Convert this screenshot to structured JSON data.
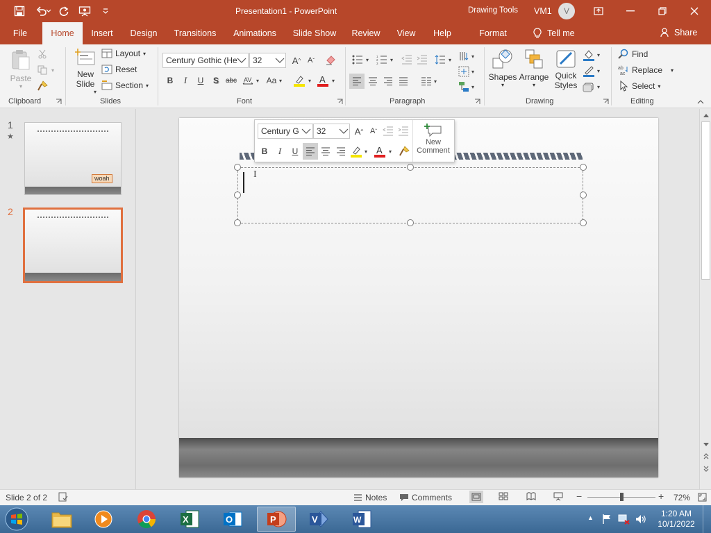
{
  "window": {
    "title": "Presentation1 - PowerPoint",
    "context_label": "Drawing Tools",
    "user_name": "VM1",
    "user_initial": "V"
  },
  "tabs": [
    "File",
    "Home",
    "Insert",
    "Design",
    "Transitions",
    "Animations",
    "Slide Show",
    "Review",
    "View",
    "Help",
    "Format"
  ],
  "active_tab": "Home",
  "tell_me": "Tell me",
  "share": "Share",
  "ribbon": {
    "clipboard": {
      "label": "Clipboard",
      "paste": "Paste"
    },
    "slides": {
      "label": "Slides",
      "new_slide_line1": "New",
      "new_slide_line2": "Slide",
      "layout": "Layout",
      "reset": "Reset",
      "section": "Section"
    },
    "font": {
      "label": "Font",
      "font_name": "Century Gothic (He",
      "font_size": "32",
      "change_case": "Aa"
    },
    "paragraph": {
      "label": "Paragraph"
    },
    "drawing": {
      "label": "Drawing",
      "shapes": "Shapes",
      "arrange": "Arrange",
      "quick_styles_line1": "Quick",
      "quick_styles_line2": "Styles"
    },
    "editing": {
      "label": "Editing",
      "find": "Find",
      "replace": "Replace",
      "select": "Select"
    }
  },
  "thumbnails": [
    {
      "number": "1",
      "tag": "woah"
    },
    {
      "number": "2"
    }
  ],
  "mini_toolbar": {
    "font_name": "Century G",
    "font_size": "32",
    "new_comment_line1": "New",
    "new_comment_line2": "Comment"
  },
  "status": {
    "slide_info": "Slide 2 of 2",
    "notes": "Notes",
    "comments": "Comments",
    "zoom": "72%",
    "zoom_fraction": 0.5
  },
  "taskbar": {
    "apps": [
      "start",
      "file-explorer",
      "media-player",
      "chrome",
      "excel",
      "outlook",
      "powerpoint",
      "visio",
      "word"
    ],
    "active_app": "powerpoint",
    "time": "1:20 AM",
    "date": "10/1/2022"
  },
  "colors": {
    "accent": "#b7472a",
    "ribbon_bg": "#f3f3f3",
    "selection_border": "#e0703f"
  }
}
